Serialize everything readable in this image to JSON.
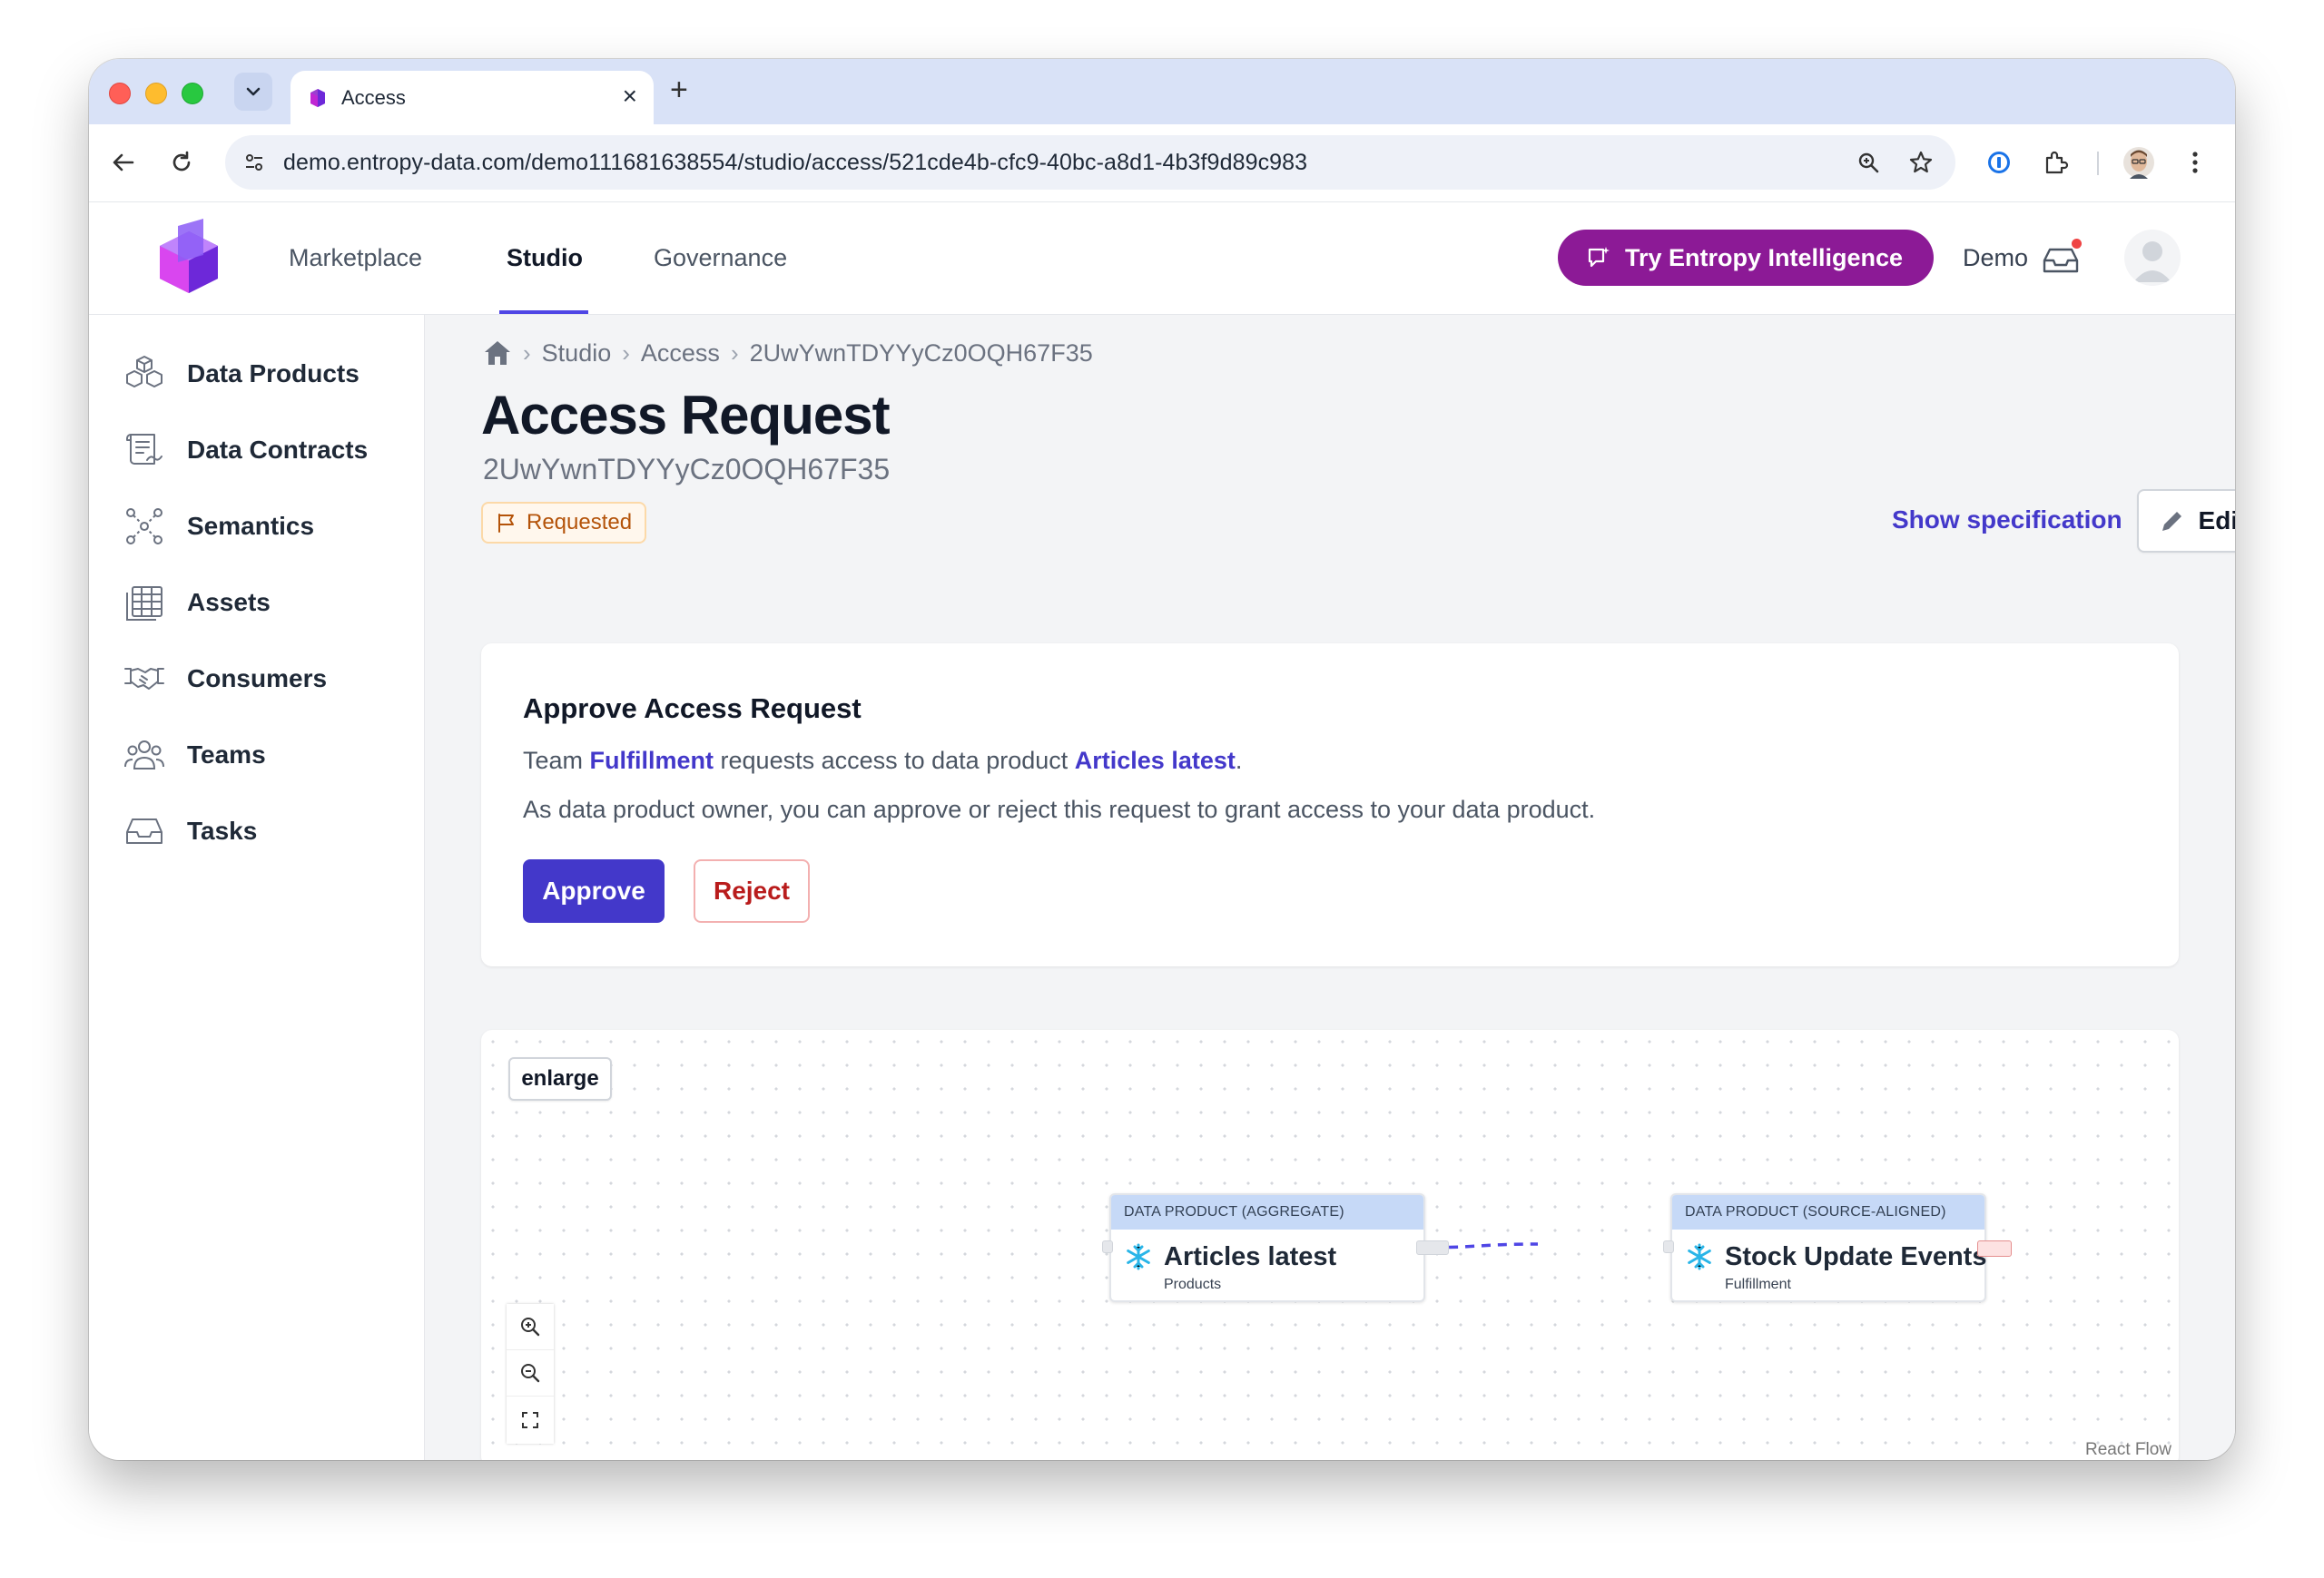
{
  "browser": {
    "tab_title": "Access",
    "url": "demo.entropy-data.com/demo111681638554/studio/access/521cde4b-cfc9-40bc-a8d1-4b3f9d89c983"
  },
  "header": {
    "nav": [
      "Marketplace",
      "Studio",
      "Governance"
    ],
    "active_nav": "Studio",
    "ai_button": "Try Entropy Intelligence",
    "org_label": "Demo"
  },
  "sidebar": {
    "items": [
      {
        "label": "Data Products",
        "icon": "cubes-icon"
      },
      {
        "label": "Data Contracts",
        "icon": "contract-icon"
      },
      {
        "label": "Semantics",
        "icon": "graph-icon"
      },
      {
        "label": "Assets",
        "icon": "table-icon"
      },
      {
        "label": "Consumers",
        "icon": "handshake-icon"
      },
      {
        "label": "Teams",
        "icon": "people-icon"
      },
      {
        "label": "Tasks",
        "icon": "inbox-icon"
      }
    ]
  },
  "breadcrumb": {
    "items": [
      "Studio",
      "Access",
      "2UwYwnTDYYyCz0OQH67F35"
    ]
  },
  "page": {
    "title": "Access Request",
    "id": "2UwYwnTDYYyCz0OQH67F35",
    "status": "Requested",
    "show_spec": "Show specification",
    "edit": "Edit"
  },
  "approve_card": {
    "title": "Approve Access Request",
    "line1_prefix": "Team ",
    "team": "Fulfillment",
    "line1_mid": " requests access to data product ",
    "product": "Articles latest",
    "line1_suffix": ".",
    "line2": "As data product owner, you can approve or reject this request to grant access to your data product.",
    "approve": "Approve",
    "reject": "Reject"
  },
  "flow": {
    "enlarge": "enlarge",
    "watermark": "React Flow",
    "nodes": [
      {
        "kind": "DATA PRODUCT (AGGREGATE)",
        "name": "Articles latest",
        "owner": "Products"
      },
      {
        "kind": "DATA PRODUCT (SOURCE-ALIGNED)",
        "name": "Stock Update Events",
        "owner": "Fulfillment"
      }
    ],
    "edge_color": "#4f46e5"
  },
  "colors": {
    "accent": "#4338ca",
    "ai_button": "#8c1a96",
    "status": "#b45309",
    "reject": "#b91c1c"
  }
}
